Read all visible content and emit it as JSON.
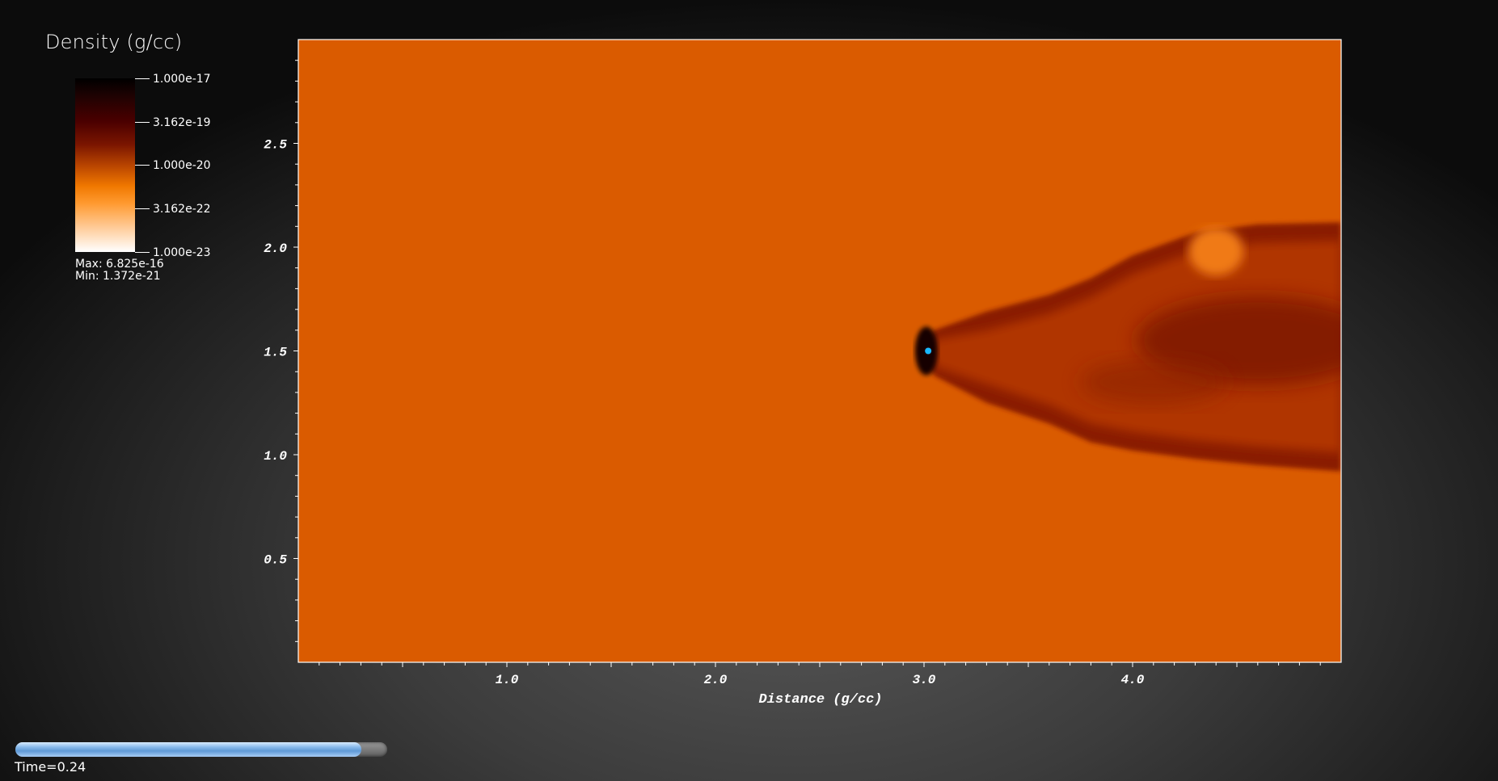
{
  "legend": {
    "title": "Density (g/cc)",
    "ticks": [
      "1.000e-17",
      "3.162e-19",
      "1.000e-20",
      "3.162e-22",
      "1.000e-23"
    ],
    "max_label": "Max:  6.825e-16",
    "min_label": "Min:  1.372e-21"
  },
  "time": {
    "label": "Time=0.24",
    "progress": 0.93
  },
  "colors": {
    "background_field": "#da5b00",
    "wake_dark": "#8a1f00",
    "wake_mid": "#b03600",
    "plume_light": "#f07a14",
    "point_marker": "#1ab8ff",
    "progress_fill": "#7fb4ea"
  },
  "chart_data": {
    "type": "heatmap",
    "title": "",
    "xlabel": "Distance (g/cc)",
    "ylabel": "",
    "xlim": [
      0,
      5.0
    ],
    "ylim": [
      0,
      3.0
    ],
    "x_ticks": [
      {
        "value": 1.0,
        "label": "1.0"
      },
      {
        "value": 2.0,
        "label": "2.0"
      },
      {
        "value": 3.0,
        "label": "3.0"
      },
      {
        "value": 4.0,
        "label": "4.0"
      }
    ],
    "y_ticks": [
      {
        "value": 0.5,
        "label": "0.5"
      },
      {
        "value": 1.0,
        "label": "1.0"
      },
      {
        "value": 1.5,
        "label": "1.5"
      },
      {
        "value": 2.0,
        "label": "2.0"
      },
      {
        "value": 2.5,
        "label": "2.5"
      }
    ],
    "colormap": "black-body (log scale)",
    "color_range": [
      1e-23,
      1e-17
    ],
    "field": {
      "bow_shock_apex": [
        2.98,
        1.5
      ],
      "outer_shell_top": [
        [
          2.98,
          1.5
        ],
        [
          3.05,
          1.6
        ],
        [
          3.3,
          1.69
        ],
        [
          3.6,
          1.77
        ],
        [
          3.8,
          1.85
        ],
        [
          4.0,
          1.96
        ],
        [
          4.3,
          2.07
        ],
        [
          4.6,
          2.11
        ],
        [
          5.0,
          2.12
        ]
      ],
      "outer_shell_bottom": [
        [
          2.98,
          1.5
        ],
        [
          3.05,
          1.38
        ],
        [
          3.3,
          1.25
        ],
        [
          3.6,
          1.15
        ],
        [
          3.8,
          1.06
        ],
        [
          4.0,
          1.02
        ],
        [
          4.3,
          0.98
        ],
        [
          4.6,
          0.95
        ],
        [
          5.0,
          0.92
        ]
      ],
      "bright_patch": [
        4.4,
        1.98
      ],
      "point_source": [
        3.02,
        1.5
      ]
    }
  }
}
